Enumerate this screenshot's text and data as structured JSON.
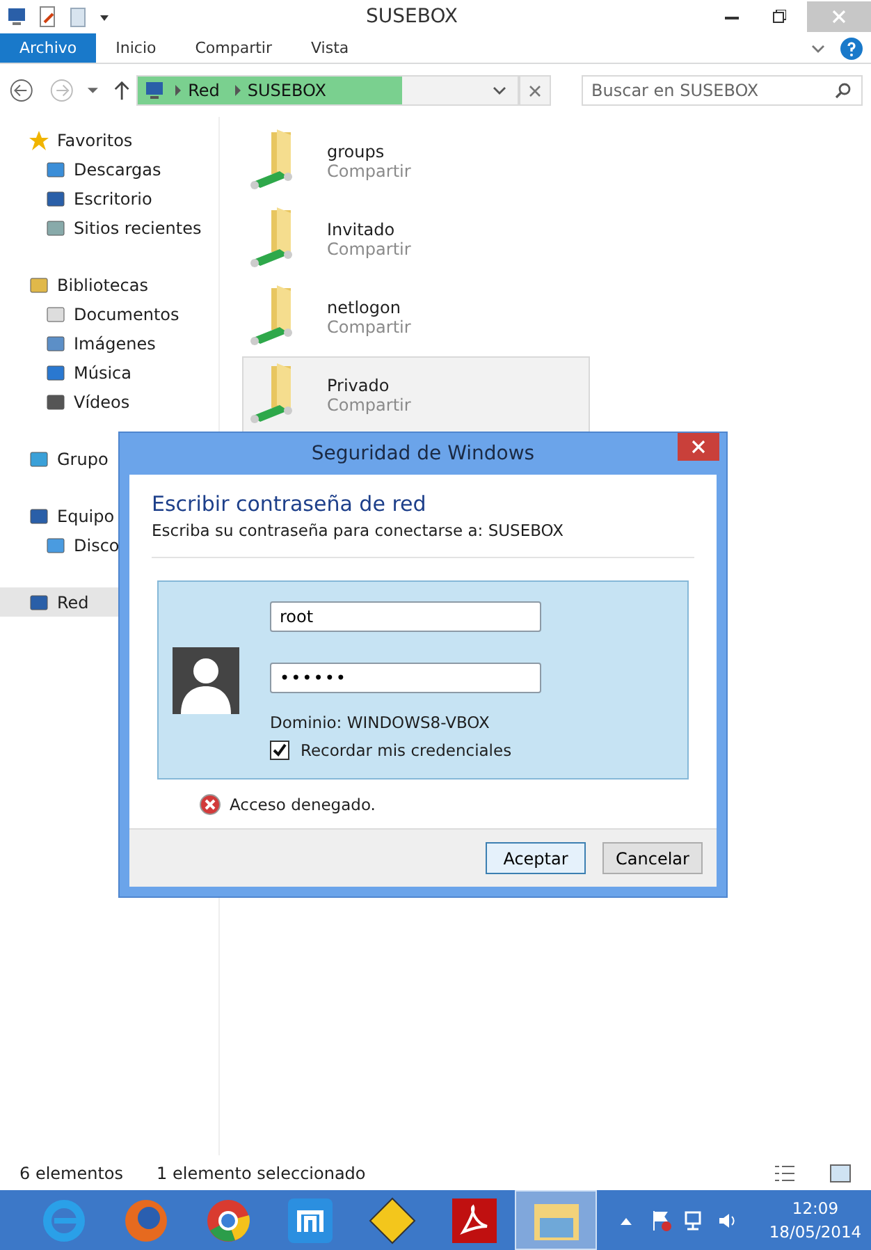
{
  "window": {
    "title": "SUSEBOX"
  },
  "ribbon_tabs": [
    {
      "label": "Archivo",
      "kind": "file"
    },
    {
      "label": "Inicio",
      "kind": "tab"
    },
    {
      "label": "Compartir",
      "kind": "tab"
    },
    {
      "label": "Vista",
      "kind": "tab"
    }
  ],
  "address_bar": {
    "path": [
      "Red",
      "SUSEBOX"
    ]
  },
  "search": {
    "placeholder": "Buscar en SUSEBOX"
  },
  "sidebar": {
    "groups": [
      {
        "label": "Favoritos",
        "selected": false,
        "children": [
          {
            "label": "Descargas",
            "selected": false
          },
          {
            "label": "Escritorio",
            "selected": false
          },
          {
            "label": "Sitios recientes",
            "selected": false
          }
        ]
      },
      {
        "label": "Bibliotecas",
        "selected": false,
        "children": [
          {
            "label": "Documentos",
            "selected": false
          },
          {
            "label": "Imágenes",
            "selected": false
          },
          {
            "label": "Música",
            "selected": false
          },
          {
            "label": "Vídeos",
            "selected": false
          }
        ]
      },
      {
        "label": "Grupo",
        "selected": false
      },
      {
        "label": "Equipo",
        "selected": false,
        "children": [
          {
            "label": "Disco",
            "selected": false
          }
        ]
      },
      {
        "label": "Red",
        "selected": true
      }
    ]
  },
  "files": [
    {
      "name": "groups",
      "type": "Compartir",
      "selected": false
    },
    {
      "name": "Invitado",
      "type": "Compartir",
      "selected": false
    },
    {
      "name": "netlogon",
      "type": "Compartir",
      "selected": false
    },
    {
      "name": "Privado",
      "type": "Compartir",
      "selected": true
    }
  ],
  "dialog": {
    "title": "Seguridad de Windows",
    "heading": "Escribir contraseña de red",
    "subtitle": "Escriba su contraseña para conectarse a: SUSEBOX",
    "username": "root",
    "password": "••••••",
    "domain": "Dominio: WINDOWS8-VBOX",
    "remember": {
      "label": "Recordar mis credenciales",
      "checked": true
    },
    "error": "Acceso denegado.",
    "buttons": [
      {
        "label": "Aceptar",
        "kind": "primary"
      },
      {
        "label": "Cancelar",
        "kind": "secondary"
      }
    ]
  },
  "status_bar": {
    "count": "6 elementos",
    "selection": "1 elemento seleccionado"
  },
  "taskbar": {
    "apps": [
      {
        "kind": "ie",
        "active": false
      },
      {
        "kind": "firefox",
        "active": false
      },
      {
        "kind": "chrome",
        "active": false
      },
      {
        "kind": "maxthon",
        "active": false
      },
      {
        "kind": "tester",
        "active": false
      },
      {
        "kind": "pdf",
        "active": false
      },
      {
        "kind": "explorer",
        "active": true
      }
    ],
    "time": "12:09",
    "date": "18/05/2014"
  }
}
